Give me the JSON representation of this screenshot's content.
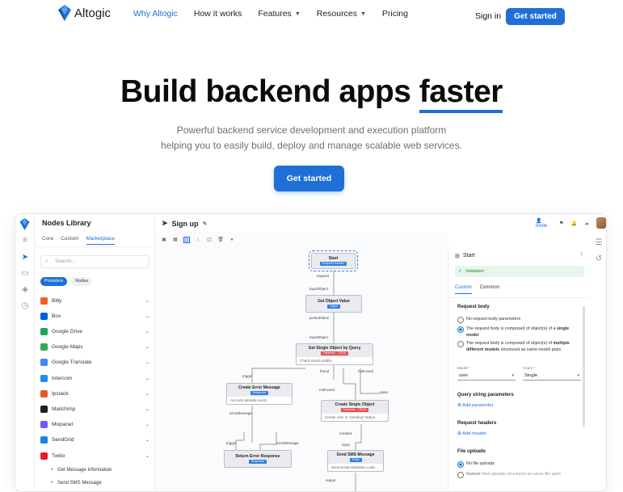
{
  "brand": {
    "name": "Altogic",
    "color": "#1f6fd6"
  },
  "nav": {
    "links": [
      {
        "label": "Why Altogic",
        "active": true,
        "dropdown": false
      },
      {
        "label": "How it works",
        "active": false,
        "dropdown": false
      },
      {
        "label": "Features",
        "active": false,
        "dropdown": true
      },
      {
        "label": "Resources",
        "active": false,
        "dropdown": true
      },
      {
        "label": "Pricing",
        "active": false,
        "dropdown": false
      }
    ],
    "signin": "Sign in",
    "cta": "Get started"
  },
  "hero": {
    "title_main": "Build backend apps ",
    "title_highlight": "faster",
    "subtitle_line1": "Powerful backend service development and execution platform",
    "subtitle_line2": "helping you to easily build, deploy and manage scalable web services.",
    "cta": "Get started"
  },
  "app": {
    "library": {
      "title": "Nodes Library",
      "tabs": [
        "Core",
        "Custom",
        "Marketplace"
      ],
      "active_tab": "Marketplace",
      "search_placeholder": "Search...",
      "pills": [
        "Providers",
        "Nodes"
      ],
      "providers": [
        {
          "name": "Bitly",
          "icon": "bitly-icon",
          "color": "#ee6123"
        },
        {
          "name": "Box",
          "icon": "box-icon",
          "color": "#0061d5"
        },
        {
          "name": "Google Drive",
          "icon": "google-drive-icon",
          "color": "#1fa463"
        },
        {
          "name": "Google Maps",
          "icon": "google-maps-icon",
          "color": "#34a853"
        },
        {
          "name": "Google Translate",
          "icon": "google-translate-icon",
          "color": "#4285f4"
        },
        {
          "name": "Intercom",
          "icon": "intercom-icon",
          "color": "#1f8ded"
        },
        {
          "name": "Ipstack",
          "icon": "ipstack-icon",
          "color": "#e05a2b"
        },
        {
          "name": "Mailchimp",
          "icon": "mailchimp-icon",
          "color": "#241c15"
        },
        {
          "name": "Mixpanel",
          "icon": "mixpanel-icon",
          "color": "#7856ff"
        },
        {
          "name": "SendGrid",
          "icon": "sendgrid-icon",
          "color": "#1a82e2"
        },
        {
          "name": "Twilio",
          "icon": "twilio-icon",
          "color": "#e31e2b"
        }
      ],
      "twilio_items": [
        "Get Message Information",
        "Send SMS Message"
      ]
    },
    "canvas": {
      "title": "Sign up",
      "nodes": {
        "start": {
          "title": "Start",
          "tag": "Endpoint Handler"
        },
        "get_value": {
          "title": "Get Object Value",
          "tag": "Object"
        },
        "get_single": {
          "title": "Get Single Object by Query",
          "tag": "Database - CRUD",
          "body": "Check email validity"
        },
        "create_error": {
          "title": "Create Error Message",
          "tag": "Response",
          "body": "Account already exists"
        },
        "create_single": {
          "title": "Create Single Object",
          "tag": "Database - CRUD",
          "body": "Create user in \"pending\" status"
        },
        "return_error": {
          "title": "Return Error Response",
          "tag": "Response"
        },
        "send_sms": {
          "title": "Send SMS Message",
          "tag": "Twilio",
          "body": "Send email validation code"
        }
      },
      "labels": {
        "request": "request",
        "inputObject1": "inputObject",
        "pickedValue": "pickedValue",
        "inputObject2": "inputObject",
        "trigger1": "trigger",
        "found": "found",
        "notFound": "notFound",
        "notFound2": "notFound",
        "input1": "input",
        "errorMessage1": "errorMessage",
        "trigger2": "trigger",
        "errorMessage2": "errorMessage",
        "created": "created",
        "input2": "input",
        "output": "output"
      }
    },
    "header": {
      "invite": "Invite"
    },
    "panel": {
      "title": "Start",
      "status": "Validated",
      "tabs": [
        "Custom",
        "Common"
      ],
      "active_tab": "Custom",
      "request_body": "Request body",
      "opt1": "No request body parameters",
      "opt2_a": "The request body is composed of object(s) of a ",
      "opt2_b": "single model",
      "opt3_a": "The request body is composed of object(s) of ",
      "opt3_b": "multiple different models",
      "opt3_c": " structured as name-model pairs",
      "model_label": "Model *",
      "model_value": "user",
      "count_label": "Count *",
      "count_value": "Single",
      "query_params": "Query string parameters",
      "add_param": "Add parameter",
      "req_headers": "Request headers",
      "add_header": "Add header",
      "file_uploads": "File uploads",
      "file_opt1": "No file uploads",
      "file_opt2_a": "Named",
      "file_opt2_b": " filed uploads structured as name-file pairs"
    }
  }
}
